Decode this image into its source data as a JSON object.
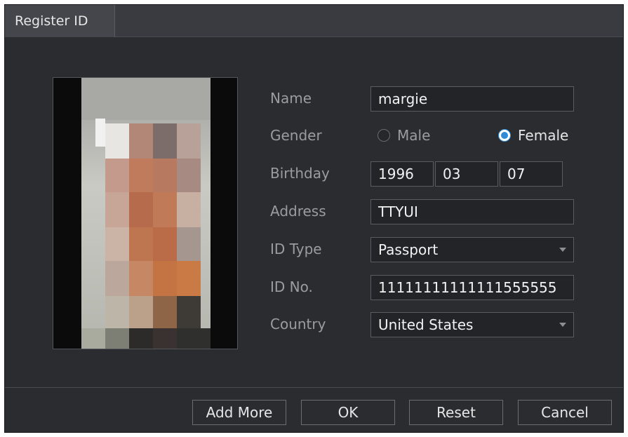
{
  "dialog": {
    "title": "Register ID"
  },
  "form": {
    "name": {
      "label": "Name",
      "value": "margie"
    },
    "gender": {
      "label": "Gender",
      "options": [
        "Male",
        "Female"
      ],
      "selected": "Female"
    },
    "birthday": {
      "label": "Birthday",
      "year": "1996",
      "month": "03",
      "day": "07"
    },
    "address": {
      "label": "Address",
      "value": "TTYUI"
    },
    "id_type": {
      "label": "ID Type",
      "value": "Passport"
    },
    "id_no": {
      "label": "ID No.",
      "value": "11111111111111555555"
    },
    "country": {
      "label": "Country",
      "value": "United States"
    }
  },
  "buttons": {
    "add_more": "Add More",
    "ok": "OK",
    "reset": "Reset",
    "cancel": "Cancel"
  },
  "colors": {
    "dialog_bg": "#2b2c30",
    "accent": "#2f8bd8",
    "label_text": "#9b9ca2"
  }
}
